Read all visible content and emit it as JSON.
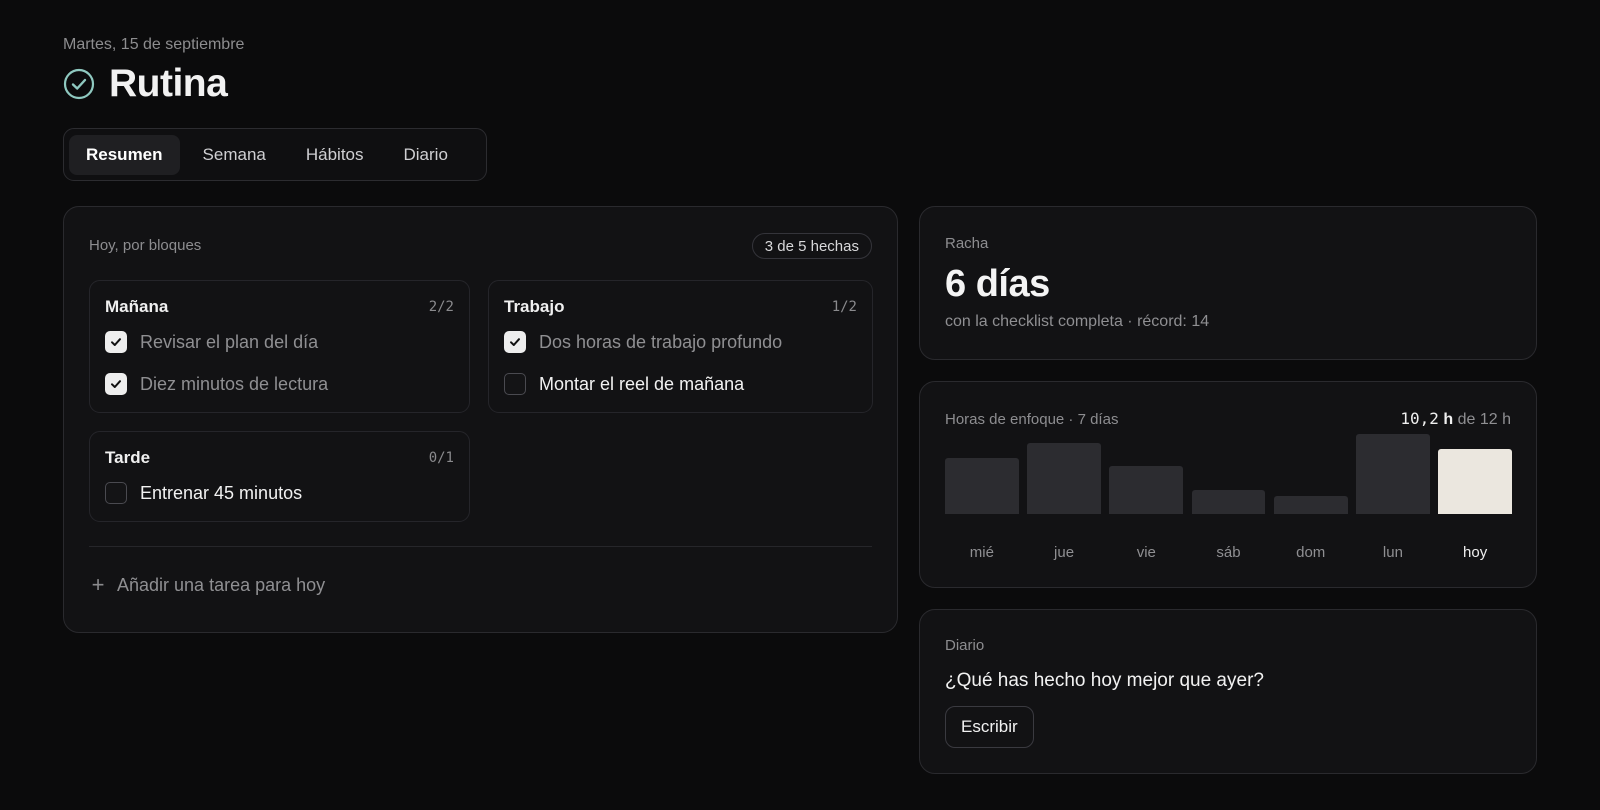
{
  "header": {
    "date": "Martes, 15 de septiembre",
    "title": "Rutina",
    "title_icon": "check-circle-icon",
    "accent_color": "#8fc9c0"
  },
  "tabs": [
    {
      "label": "Resumen",
      "active": true
    },
    {
      "label": "Semana",
      "active": false
    },
    {
      "label": "Hábitos",
      "active": false
    },
    {
      "label": "Diario",
      "active": false
    }
  ],
  "blocks_card": {
    "label": "Hoy, por bloques",
    "badge": "3 de 5 hechas",
    "blocks": [
      {
        "name": "Mañana",
        "count": "2/2",
        "tasks": [
          {
            "text": "Revisar el plan del día",
            "done": true
          },
          {
            "text": "Diez minutos de lectura",
            "done": true
          }
        ]
      },
      {
        "name": "Trabajo",
        "count": "1/2",
        "tasks": [
          {
            "text": "Dos horas de trabajo profundo",
            "done": true
          },
          {
            "text": "Montar el reel de mañana",
            "done": false
          }
        ]
      },
      {
        "name": "Tarde",
        "count": "0/1",
        "tasks": [
          {
            "text": "Entrenar 45 minutos",
            "done": false
          }
        ]
      }
    ],
    "add_task": "Añadir una tarea para hoy"
  },
  "streak": {
    "label": "Racha",
    "value": "6 días",
    "subtitle": "con la checklist completa · récord: 14"
  },
  "focus": {
    "label": "Horas de enfoque · 7 días",
    "total_value": "10,2",
    "total_unit": "h",
    "total_rest": "de 12 h",
    "bar_color": "#2c2c30",
    "today_color": "#ebe7df"
  },
  "chart_data": {
    "type": "bar",
    "categories": [
      "mié",
      "jue",
      "vie",
      "sáb",
      "dom",
      "lun",
      "hoy"
    ],
    "values": [
      7.5,
      9.5,
      6.4,
      3.2,
      2.4,
      10.7,
      8.7
    ],
    "highlight": "hoy"
  },
  "diary": {
    "label": "Diario",
    "question": "¿Qué has hecho hoy mejor que ayer?",
    "button": "Escribir"
  }
}
